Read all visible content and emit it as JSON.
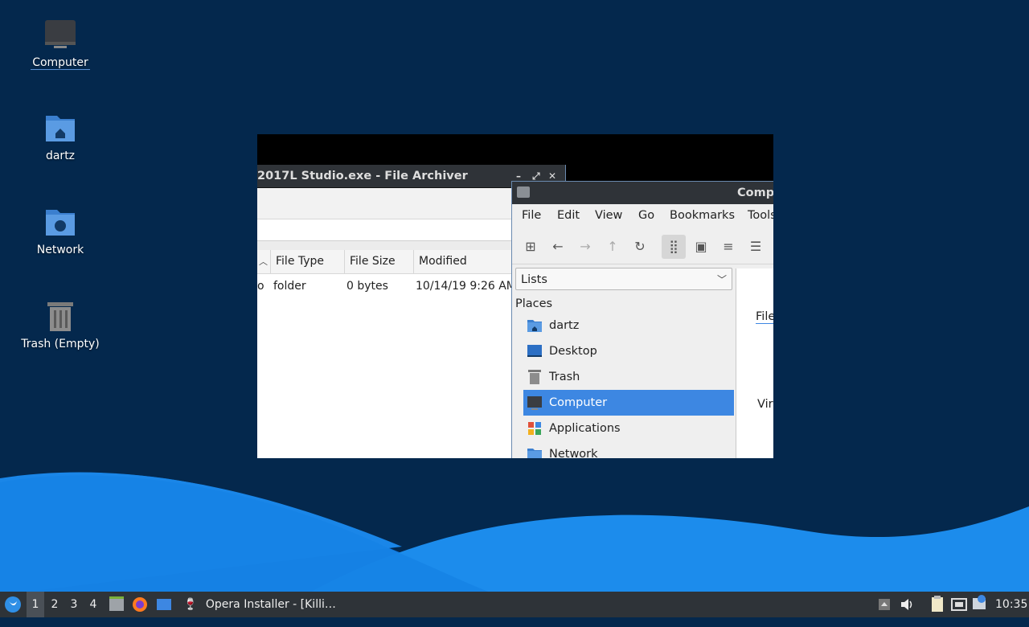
{
  "desktop": {
    "icons": [
      {
        "label": "Computer",
        "icon": "computer-icon"
      },
      {
        "label": "dartz",
        "icon": "home-folder-icon"
      },
      {
        "label": "Network",
        "icon": "network-folder-icon"
      },
      {
        "label": "Trash (Empty)",
        "icon": "trash-icon"
      }
    ]
  },
  "archiver": {
    "title": "2017L Studio.exe - File Archiver",
    "controls": {
      "minimize": "–",
      "maximize": "⤢",
      "close": "✕"
    },
    "columns": [
      "File Type",
      "File Size",
      "Modified"
    ],
    "sort_indicator": "^",
    "rows": [
      {
        "name_fragment": "o",
        "type": "folder",
        "size": "0 bytes",
        "modified": "10/14/19 9:26 AM"
      }
    ]
  },
  "file_manager": {
    "title": "Comp",
    "menu": [
      "File",
      "Edit",
      "View",
      "Go",
      "Bookmarks",
      "Tools"
    ],
    "toolbar": [
      "new-tab-icon",
      "back-icon",
      "forward-icon",
      "up-icon",
      "reload-icon",
      "icon-view-icon",
      "thumbnail-view-icon",
      "compact-view-icon",
      "detail-view-icon"
    ],
    "side_pane_mode": "Lists",
    "places_label": "Places",
    "places": [
      {
        "label": "dartz",
        "icon": "home-folder-icon"
      },
      {
        "label": "Desktop",
        "icon": "desktop-icon"
      },
      {
        "label": "Trash",
        "icon": "trash-icon"
      },
      {
        "label": "Computer",
        "icon": "computer-icon",
        "selected": true
      },
      {
        "label": "Applications",
        "icon": "applications-icon"
      },
      {
        "label": "Network",
        "icon": "network-folder-icon"
      }
    ],
    "main_fragments": [
      "File",
      "Vir"
    ]
  },
  "taskbar": {
    "workspaces": [
      "1",
      "2",
      "3",
      "4"
    ],
    "active_workspace": "1",
    "task_label": "Opera Installer - [Killi…",
    "clock": "10:35"
  },
  "colors": {
    "desktop_bg": "#04284d",
    "wave_light": "#1e90f0",
    "selection": "#3d87e2",
    "taskbar_bg": "#2e3338"
  }
}
